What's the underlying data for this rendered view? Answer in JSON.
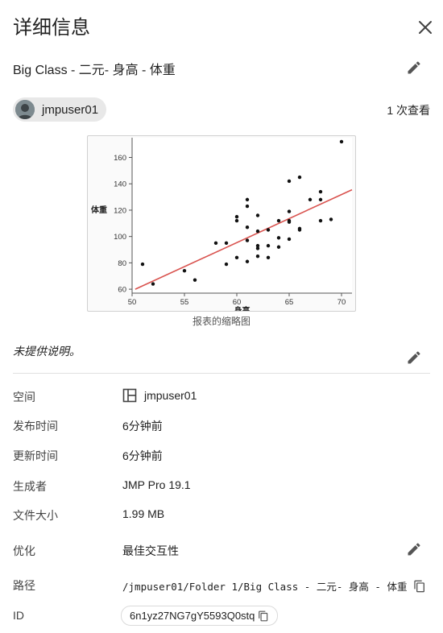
{
  "header": {
    "title": "详细信息"
  },
  "report": {
    "title": "Big Class - 二元- 身高 - 体重"
  },
  "owner": {
    "name": "jmpuser01"
  },
  "views": {
    "text": "1 次查看"
  },
  "thumbnail": {
    "caption": "报表的缩略图",
    "chart_data": {
      "type": "scatter",
      "xlabel": "身高",
      "ylabel": "体重",
      "xlim": [
        50,
        71
      ],
      "ylim": [
        57,
        175
      ],
      "xticks": [
        50,
        55,
        60,
        65,
        70
      ],
      "yticks": [
        60,
        80,
        100,
        120,
        140,
        160
      ],
      "points": [
        [
          51,
          79
        ],
        [
          52,
          64
        ],
        [
          55,
          74
        ],
        [
          56,
          67
        ],
        [
          58,
          95
        ],
        [
          59,
          95
        ],
        [
          59,
          79
        ],
        [
          60,
          115
        ],
        [
          60,
          112
        ],
        [
          60,
          84
        ],
        [
          61,
          128
        ],
        [
          61,
          123
        ],
        [
          61,
          107
        ],
        [
          61,
          97
        ],
        [
          61,
          81
        ],
        [
          62,
          116
        ],
        [
          62,
          104
        ],
        [
          62,
          93
        ],
        [
          62,
          91
        ],
        [
          62,
          85
        ],
        [
          63,
          105
        ],
        [
          63,
          93
        ],
        [
          63,
          84
        ],
        [
          64,
          112
        ],
        [
          64,
          99
        ],
        [
          64,
          92
        ],
        [
          65,
          142
        ],
        [
          65,
          119
        ],
        [
          65,
          112
        ],
        [
          65,
          111
        ],
        [
          65,
          98
        ],
        [
          66,
          145
        ],
        [
          66,
          106
        ],
        [
          66,
          105
        ],
        [
          67,
          128
        ],
        [
          68,
          134
        ],
        [
          68,
          128
        ],
        [
          68,
          112
        ],
        [
          69,
          113
        ],
        [
          70,
          172
        ]
      ],
      "fit_line": {
        "x": [
          50.3,
          71
        ],
        "y": [
          60,
          135.5
        ],
        "color": "#d9534f"
      }
    }
  },
  "description": {
    "text": "未提供说明。"
  },
  "properties": {
    "space_label": "空间",
    "space_value": "jmpuser01",
    "published_label": "发布时间",
    "published_value": "6分钟前",
    "updated_label": "更新时间",
    "updated_value": "6分钟前",
    "generator_label": "生成者",
    "generator_value": "JMP Pro 19.1",
    "size_label": "文件大小",
    "size_value": "1.99 MB",
    "optimization_label": "优化",
    "optimization_value": "最佳交互性",
    "path_label": "路径",
    "path_value": "/jmpuser01/Folder 1/Big Class - 二元- 身高 - 体重",
    "id_label": "ID",
    "id_value": "6n1yz27NG7gY5593Q0stq"
  },
  "icons": {
    "close": "close-icon",
    "edit": "pencil-icon",
    "copy": "copy-icon",
    "space": "space-icon",
    "avatar": "person-avatar"
  }
}
